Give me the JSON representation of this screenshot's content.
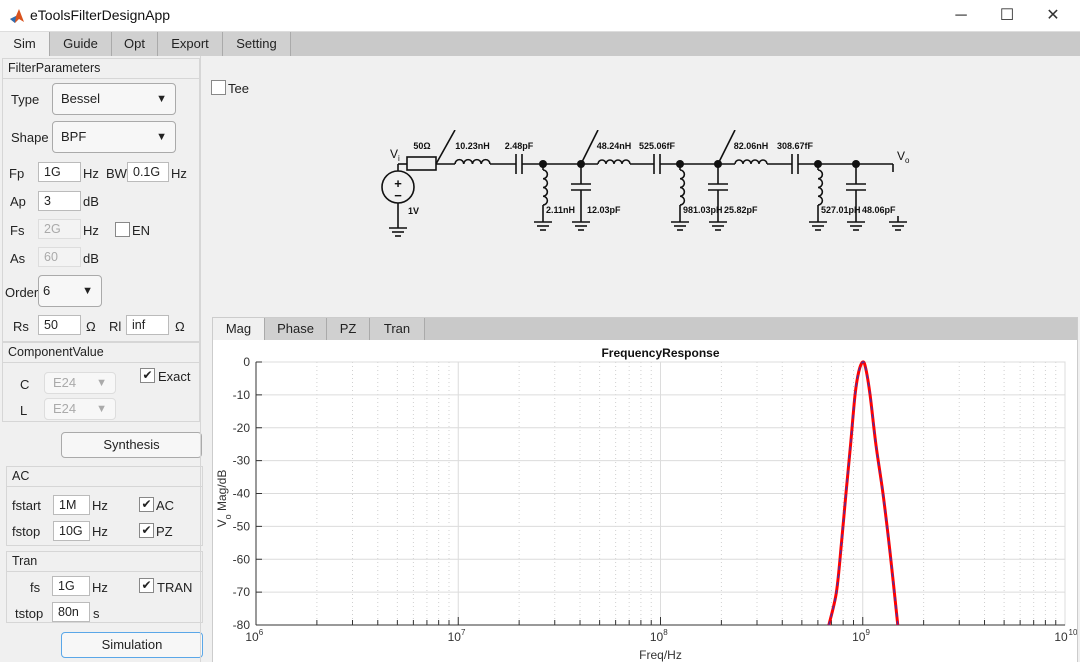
{
  "window": {
    "title": "eToolsFilterDesignApp",
    "minimize": "─",
    "maximize": "☐",
    "close": "✕"
  },
  "tabs": [
    "Sim",
    "Guide",
    "Opt",
    "Export",
    "Setting"
  ],
  "filter_params": {
    "title": "FilterParameters",
    "type_label": "Type",
    "type_value": "Bessel",
    "shape_label": "Shape",
    "shape_value": "BPF",
    "fp_label": "Fp",
    "fp_value": "1G",
    "fp_unit": "Hz",
    "bw_label": "BW",
    "bw_value": "0.1G",
    "bw_unit": "Hz",
    "ap_label": "Ap",
    "ap_value": "3",
    "ap_unit": "dB",
    "fs_label": "Fs",
    "fs_value": "2G",
    "fs_unit": "Hz",
    "en_label": "EN",
    "en_checked": false,
    "as_label": "As",
    "as_value": "60",
    "as_unit": "dB",
    "order_label": "Order",
    "order_value": "6",
    "rs_label": "Rs",
    "rs_value": "50",
    "rs_unit": "Ω",
    "rl_label": "Rl",
    "rl_value": "inf",
    "rl_unit": "Ω"
  },
  "component_value": {
    "title": "ComponentValue",
    "c_label": "C",
    "c_value": "E24",
    "l_label": "L",
    "l_value": "E24",
    "exact_label": "Exact",
    "exact_checked": true
  },
  "synthesis_button": "Synthesis",
  "ac": {
    "title": "AC",
    "fstart_label": "fstart",
    "fstart_value": "1M",
    "fstart_unit": "Hz",
    "fstop_label": "fstop",
    "fstop_value": "10G",
    "fstop_unit": "Hz",
    "ac_label": "AC",
    "pz_label": "PZ",
    "ac_checked": true,
    "pz_checked": true
  },
  "tran": {
    "title": "Tran",
    "fs_label": "fs",
    "fs_value": "1G",
    "fs_unit": "Hz",
    "tstop_label": "tstop",
    "tstop_value": "80n",
    "tstop_unit": "s",
    "tran_label": "TRAN",
    "tran_checked": true
  },
  "simulation_button": "Simulation",
  "tee": {
    "label": "Tee",
    "checked": false
  },
  "schematic": {
    "vi": "V",
    "vi_sub": "i",
    "vo": "V",
    "vo_sub": "o",
    "source": "1V",
    "rs": "50Ω",
    "series": [
      "10.23nH",
      "2.48pF",
      "48.24nH",
      "525.06fF",
      "82.06nH",
      "308.67fF"
    ],
    "shunt": [
      "2.11nH",
      "12.03pF",
      "981.03pH",
      "25.82pF",
      "527.01pH",
      "48.06pF"
    ]
  },
  "plot_tabs": [
    "Mag",
    "Phase",
    "PZ",
    "Tran"
  ],
  "chart_data": {
    "type": "line",
    "title": "FrequencyResponse",
    "xlabel": "Freq/Hz",
    "ylabel_main": "V",
    "ylabel_sub": "o",
    "ylabel_rest": " Mag/dB",
    "xscale": "log",
    "xlim": [
      1000000,
      10000000000
    ],
    "ylim": [
      -80,
      0
    ],
    "grid": true,
    "yticks": [
      "0",
      "-10",
      "-20",
      "-30",
      "-40",
      "-50",
      "-60",
      "-70",
      "-80"
    ],
    "xticks": [
      {
        "base": "10",
        "exp": "6"
      },
      {
        "base": "10",
        "exp": "7"
      },
      {
        "base": "10",
        "exp": "8"
      },
      {
        "base": "10",
        "exp": "9"
      },
      {
        "base": "10",
        "exp": "10"
      }
    ],
    "line_color": "#ff0000",
    "overlay_color": "#5a2a9a",
    "x": [
      680000000,
      741000000,
      785000000,
      826000000,
      871000000,
      916000000,
      955000000,
      1000000000,
      1035000000,
      1087000000,
      1161000000,
      1259000000,
      1365000000,
      1490000000
    ],
    "y": [
      -80,
      -70,
      -55,
      -40,
      -25,
      -10,
      -3,
      0,
      -2,
      -10,
      -25,
      -40,
      -58,
      -80
    ]
  }
}
